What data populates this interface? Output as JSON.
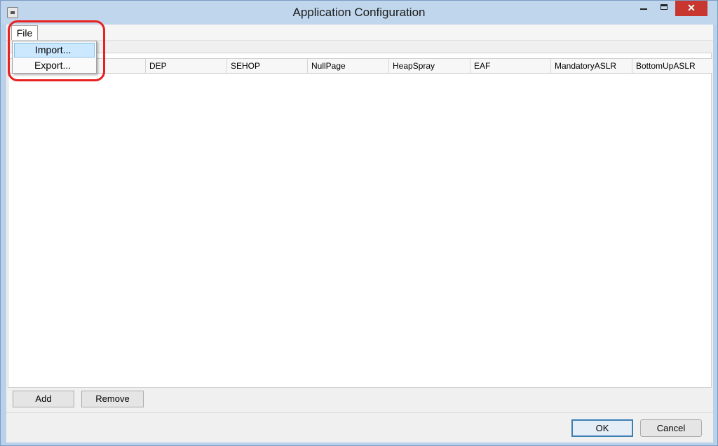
{
  "window": {
    "title": "Application Configuration",
    "close_glyph": "✕"
  },
  "menu": {
    "file_label": "File",
    "items": [
      {
        "label": "Import..."
      },
      {
        "label": "Export..."
      }
    ]
  },
  "grid": {
    "columns": [
      "",
      "DEP",
      "SEHOP",
      "NullPage",
      "HeapSpray",
      "EAF",
      "MandatoryASLR",
      "BottomUpASLR"
    ],
    "rows": []
  },
  "buttons": {
    "add": "Add",
    "remove": "Remove",
    "ok": "OK",
    "cancel": "Cancel"
  },
  "colors": {
    "title_bar": "#c0d6ec",
    "close_button": "#c7372f",
    "annotation_ring": "#e8201f",
    "menu_highlight": "#cce8ff"
  },
  "icons": [
    "app-icon",
    "minimize-icon",
    "maximize-icon",
    "close-icon"
  ]
}
